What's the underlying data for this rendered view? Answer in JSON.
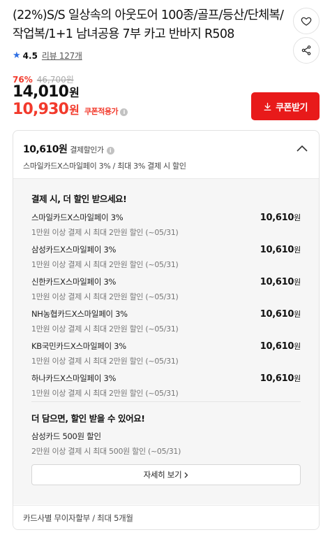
{
  "product": {
    "title": "(22%)S/S 일상속의 아웃도어 100종/골프/등산/단체복/작업복/1+1 남녀공용 7부 카고 반바지 R508",
    "rating": "4.5",
    "reviews": "리뷰 127개",
    "discount_rate": "76%",
    "original_price": "46,700원",
    "price": "14,010",
    "price_unit": "원",
    "coupon_price": "10,930",
    "coupon_price_unit": "원",
    "coupon_price_label": "쿠폰적용가",
    "coupon_button": "쿠폰받기"
  },
  "payment_discount": {
    "price": "10,610원",
    "label": "결제할인가",
    "summary": "스마일카드X스마일페이 3% / 최대 3% 결제 시 할인",
    "section_title": "결제 시, 더 할인 받으세요!",
    "cards": [
      {
        "name": "스마일카드X스마일페이 3%",
        "condition": "1만원 이상 결제 시 최대 2만원 할인 (~05/31)",
        "amount": "10,610",
        "unit": "원"
      },
      {
        "name": "삼성카드X스마일페이 3%",
        "condition": "1만원 이상 결제 시 최대 2만원 할인 (~05/31)",
        "amount": "10,610",
        "unit": "원"
      },
      {
        "name": "신한카드X스마일페이 3%",
        "condition": "1만원 이상 결제 시 최대 2만원 할인 (~05/31)",
        "amount": "10,610",
        "unit": "원"
      },
      {
        "name": "NH농협카드X스마일페이 3%",
        "condition": "1만원 이상 결제 시 최대 2만원 할인 (~05/31)",
        "amount": "10,610",
        "unit": "원"
      },
      {
        "name": "KB국민카드X스마일페이 3%",
        "condition": "1만원 이상 결제 시 최대 2만원 할인 (~05/31)",
        "amount": "10,610",
        "unit": "원"
      },
      {
        "name": "하나카드X스마일페이 3%",
        "condition": "1만원 이상 결제 시 최대 2만원 할인 (~05/31)",
        "amount": "10,610",
        "unit": "원"
      }
    ],
    "extra_title": "더 담으면, 할인 받을 수 있어요!",
    "extra_name": "삼성카드 500원 할인",
    "extra_condition": "2만원 이상 결제 시 최대 500원 할인 (~05/31)",
    "more_button": "자세히 보기",
    "installment": "카드사별 무이자할부 / 최대 5개월"
  },
  "icons": {
    "heart": "heart-icon",
    "share": "share-icon",
    "star": "star-icon",
    "download": "download-icon",
    "chevron_up": "chevron-up-icon",
    "info": "info-icon",
    "chevron_right": "chevron-right-icon"
  },
  "colors": {
    "accent_red": "#e81a1a",
    "price_red": "#f23a2c",
    "star_blue": "#2f6fe4"
  }
}
